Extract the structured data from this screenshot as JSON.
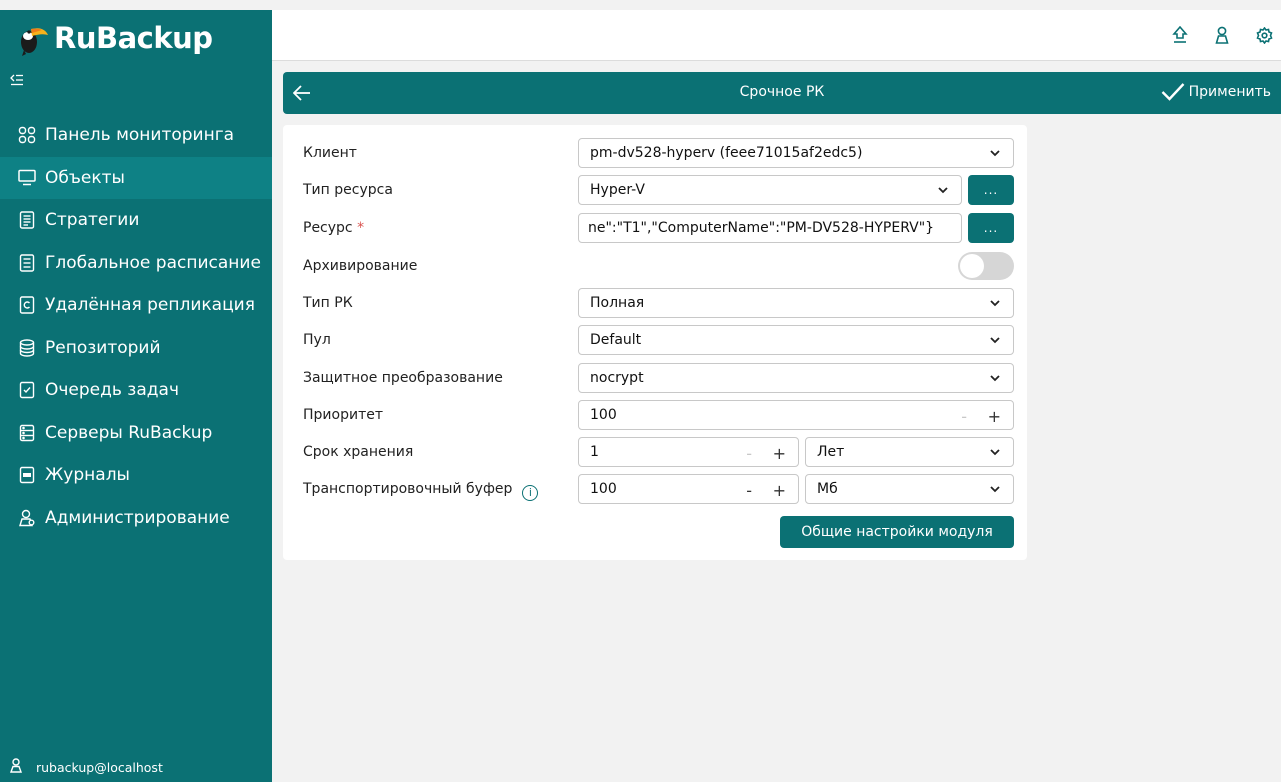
{
  "app": {
    "logo_ru": "Ru",
    "logo_backup": "Backup",
    "brand_color": "#0b7174"
  },
  "sidebar": {
    "collapse_icon": "collapse-menu-icon",
    "items": [
      {
        "label": "Панель мониторинга",
        "icon": "dashboard-icon"
      },
      {
        "label": "Объекты",
        "icon": "monitor-icon",
        "active": true
      },
      {
        "label": "Стратегии",
        "icon": "document-icon"
      },
      {
        "label": "Глобальное расписание",
        "icon": "schedule-icon"
      },
      {
        "label": "Удалённая репликация",
        "icon": "replication-icon"
      },
      {
        "label": "Репозиторий",
        "icon": "database-icon"
      },
      {
        "label": "Очередь задач",
        "icon": "task-queue-icon"
      },
      {
        "label": "Серверы RuBackup",
        "icon": "server-icon"
      },
      {
        "label": "Журналы",
        "icon": "log-icon"
      },
      {
        "label": "Администрирование",
        "icon": "admin-user-icon"
      }
    ],
    "user": "rubackup@localhost"
  },
  "topbar": {
    "icons": [
      "upload-icon",
      "user-icon",
      "settings-icon"
    ]
  },
  "header": {
    "title": "Срочное РК",
    "apply_label": "Применить"
  },
  "form": {
    "client": {
      "label": "Клиент",
      "value": "pm-dv528-hyperv (feee71015af2edc5)"
    },
    "resource_type": {
      "label": "Тип ресурса",
      "value": "Hyper-V",
      "button": "..."
    },
    "resource": {
      "label": "Ресурс",
      "required_mark": "*",
      "value": "ne\":\"T1\",\"ComputerName\":\"PM-DV528-HYPERV\"}",
      "button": "..."
    },
    "archiving": {
      "label": "Архивирование",
      "enabled": false
    },
    "backup_type": {
      "label": "Тип РК",
      "value": "Полная"
    },
    "pool": {
      "label": "Пул",
      "value": "Default"
    },
    "protective_transform": {
      "label": "Защитное преобразование",
      "value": "nocrypt"
    },
    "priority": {
      "label": "Приоритет",
      "value": "100",
      "minus": "-",
      "plus": "+"
    },
    "retention": {
      "label": "Срок хранения",
      "value": "1",
      "minus": "-",
      "plus": "+",
      "unit": "Лет"
    },
    "transport_buffer": {
      "label": "Транспортировочный буфер",
      "info_icon": "i",
      "value": "100",
      "minus": "-",
      "plus": "+",
      "unit": "Мб"
    },
    "module_settings_button": "Общие настройки модуля"
  }
}
